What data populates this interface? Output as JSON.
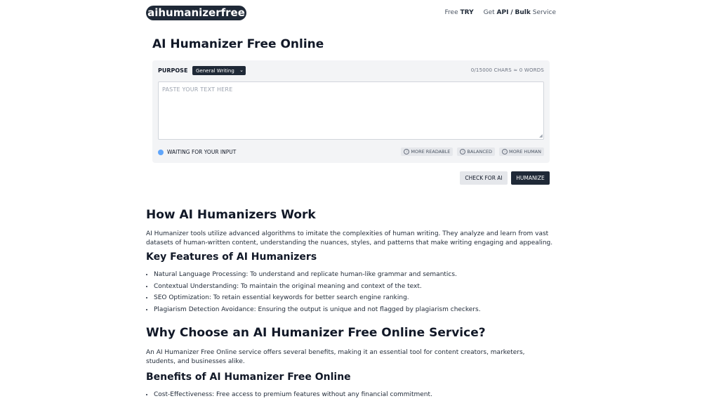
{
  "header": {
    "logo": "aihumanizerfree",
    "nav": {
      "free_prefix": "Free",
      "free_strong": "TRY",
      "get_prefix": "Get",
      "api": "API",
      "separator": "/",
      "bulk": "Bulk",
      "service": "Service"
    }
  },
  "page_title": "AI Humanizer Free Online",
  "tool": {
    "purpose_label": "PURPOSE",
    "purpose_selected": "General Writing",
    "counter": "0/15000 CHARS ≈ 0 WORDS",
    "textarea_placeholder": "PASTE YOUR TEXT HERE",
    "status": "WAITING FOR YOUR INPUT",
    "status_color": "#60a5fa",
    "modes": [
      "MORE READABLE",
      "BALANCED",
      "MORE HUMAN"
    ]
  },
  "actions": {
    "check": "CHECK FOR AI",
    "humanize": "HUMANIZE"
  },
  "article": {
    "h2_how": "How AI Humanizers Work",
    "p_how": "AI Humanizer tools utilize advanced algorithms to imitate the complexities of human writing. They analyze and learn from vast datasets of human-written content, understanding the nuances, styles, and patterns that make writing engaging and appealing.",
    "h3_features": "Key Features of AI Humanizers",
    "features": [
      "Natural Language Processing: To understand and replicate human-like grammar and semantics.",
      "Contextual Understanding: To maintain the original meaning and context of the text.",
      "SEO Optimization: To retain essential keywords for better search engine ranking.",
      "Plagiarism Detection Avoidance: Ensuring the output is unique and not flagged by plagiarism checkers."
    ],
    "h2_why": "Why Choose an AI Humanizer Free Online Service?",
    "p_why": "An AI Humanizer Free Online service offers several benefits, making it an essential tool for content creators, marketers, students, and businesses alike.",
    "h3_benefits": "Benefits of AI Humanizer Free Online",
    "benefits": [
      "Cost-Effectiveness: Free access to premium features without any financial commitment."
    ]
  }
}
